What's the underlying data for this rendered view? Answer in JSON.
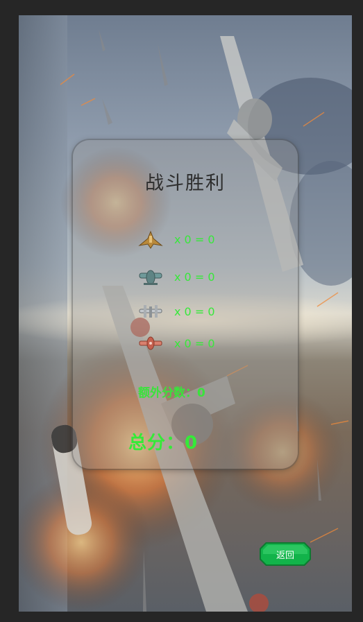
{
  "result_dialog": {
    "title": "战斗胜利",
    "kills": [
      {
        "icon": "gold-fighter-plane-icon",
        "text": "x 0 = 0"
      },
      {
        "icon": "teal-bomber-plane-icon",
        "text": "x 0 = 0"
      },
      {
        "icon": "gray-twin-plane-icon",
        "text": "x 0 = 0"
      },
      {
        "icon": "red-fighter-plane-icon",
        "text": "x 0 = 0"
      }
    ],
    "bonus_score": "额外分数：0",
    "total_score": "总分：0"
  },
  "back_button": {
    "label": "返回",
    "color": "#0fa845"
  },
  "colors": {
    "score_text": "#37e83a",
    "title_text": "#2e2e2e"
  }
}
